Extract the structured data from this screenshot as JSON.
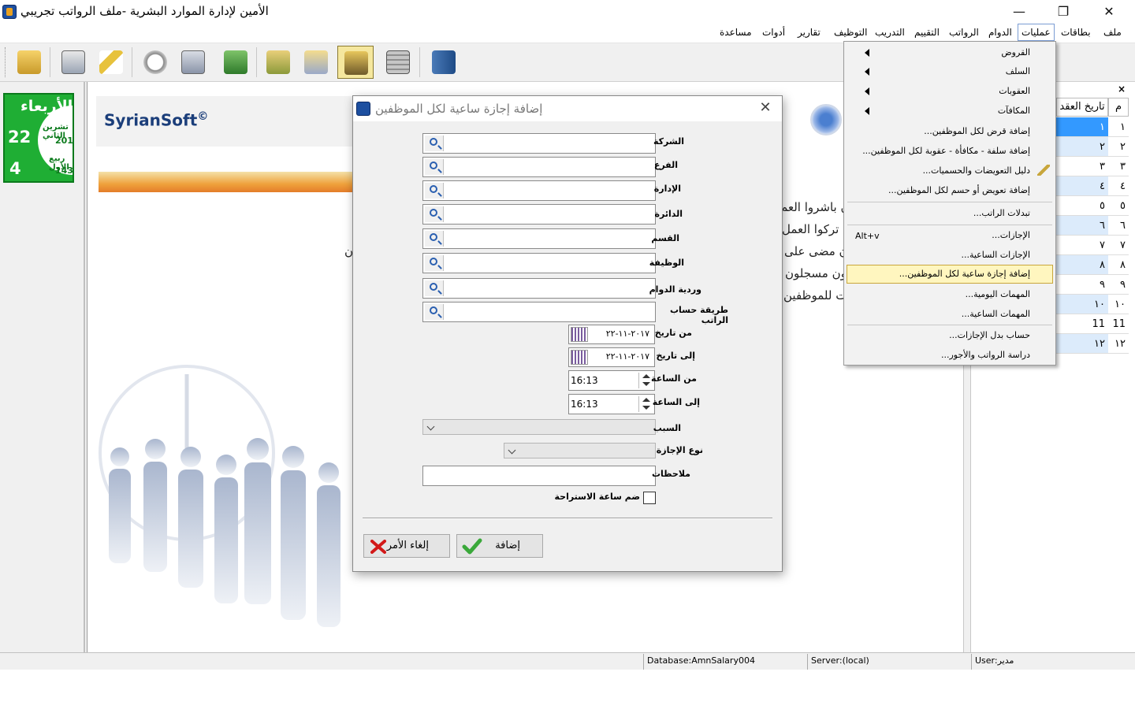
{
  "window": {
    "title": "الأمين لإدارة الموارد البشرية -ملف الرواتب تجريبي",
    "minimize": "—",
    "restore": "❐",
    "close": "✕"
  },
  "menubar": {
    "items": [
      "ملف",
      "بطاقات",
      "عمليات",
      "الدوام",
      "الرواتب",
      "التقييم",
      "التدريب",
      "التوظيف",
      "تقارير",
      "أدوات",
      "مساعدة"
    ],
    "active": "عمليات"
  },
  "toolbar": {
    "buttons": [
      "open-folder",
      "employee-card",
      "tools-wrench",
      "clock",
      "timesheet",
      "cash",
      "books",
      "documents",
      "employees-folder",
      "calculator",
      "exit-door"
    ],
    "selected": "employees-folder"
  },
  "date_widget": {
    "day": "الأربعاء",
    "greg_month": "تشرين الثاني",
    "greg_day": "22",
    "greg_year": "2017",
    "hijri_month": "ربيع الأول",
    "hijri_day": "4",
    "hijri_year": "1439"
  },
  "logo": {
    "text": "SyrianSoft",
    "mark": "©"
  },
  "background_text": {
    "l1": "ن باشروا العم",
    "l2": "ن تركوا العمل",
    "l3": "ن مضى على",
    "l4": "ون مسجلون",
    "l5": "ت للموظفين",
    "l6": "(ن"
  },
  "side_table": {
    "close": "×",
    "headers": [
      "م",
      "تاريخ العقد"
    ],
    "rows": [
      [
        "١",
        "١"
      ],
      [
        "٢",
        "٢"
      ],
      [
        "٣",
        "٣"
      ],
      [
        "٤",
        "٤"
      ],
      [
        "٥",
        "٥"
      ],
      [
        "٦",
        "٦"
      ],
      [
        "٧",
        "٧"
      ],
      [
        "٨",
        "٨"
      ],
      [
        "٩",
        "٩"
      ],
      [
        "١٠",
        "١٠"
      ],
      [
        "11",
        "11"
      ],
      [
        "١٢",
        "١٢"
      ]
    ]
  },
  "statusbar": {
    "database": "Database:AmnSalary004",
    "server": "Server:(local)",
    "user": "User:مدير"
  },
  "dropdown": {
    "items": [
      "القروض",
      "السلف",
      "العقوبات",
      "المكافآت",
      "إضافة قرض لكل الموظفين...",
      "إضافة سلفة - مكافأة - عقوبة لكل الموظفين...",
      "دليل التعويضات والحسميات...",
      "إضافة تعويض أو حسم لكل الموظفين...",
      "تبدلات الراتب...",
      "الإجازات...",
      "الإجازات الساعية...",
      "إضافة إجازة ساعية لكل الموظفين...",
      "المهمات اليومية...",
      "المهمات الساعية...",
      "حساب بدل الإجازات...",
      "دراسة الرواتب والأجور..."
    ],
    "shortcut": "Alt+v"
  },
  "dialog": {
    "title": "إضافة إجازة ساعية لكل الموظفين",
    "close": "✕",
    "labels": {
      "company": "الشركة",
      "branch": "الفرع",
      "administration": "الإدارة",
      "department": "الدائرة",
      "section": "القسم",
      "job": "الوظيفة",
      "shift": "وردية الدوام",
      "salary_method": "طريقة حساب الراتب",
      "from_date": "من تاريخ",
      "to_date": "إلى تاريخ",
      "from_time": "من الساعة",
      "to_time": "إلى الساعة",
      "reason": "السبب",
      "leave_type": "نوع الإجازة",
      "notes": "ملاحظات",
      "include_rest": "ضم ساعة الاستراحة"
    },
    "values": {
      "from_date": "٢٠١٧-١١-٢٢",
      "to_date": "٢٠١٧-١١-٢٢",
      "from_time": "16:13",
      "to_time": "16:13"
    },
    "buttons": {
      "cancel": "إلغاء الأمر",
      "add": "إضافة"
    }
  },
  "colors": {
    "accent_highlight": "#fff6bf",
    "selection_blue": "#3399ff",
    "date_green": "#1fae34",
    "logo_blue": "#1b3e7a"
  }
}
